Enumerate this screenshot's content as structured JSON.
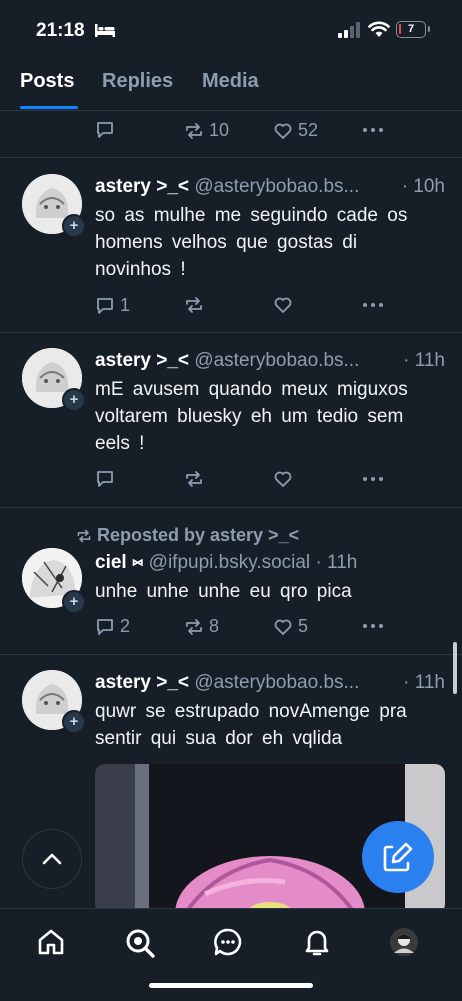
{
  "status_bar": {
    "time": "21:18",
    "battery": "7",
    "battery_level": 0.07,
    "battery_color": "#e5484d"
  },
  "tabs": [
    {
      "label": "Posts",
      "active": true
    },
    {
      "label": "Replies",
      "active": false
    },
    {
      "label": "Media",
      "active": false
    }
  ],
  "colors": {
    "background": "#161e27",
    "accent": "#1083fe",
    "muted": "#8d9db0",
    "compose": "#2a80ef"
  },
  "top_partial": {
    "reposts": "10",
    "likes": "52"
  },
  "posts": [
    {
      "name": "astery >_<",
      "handle": "@asterybobao.bs...",
      "time": "· 10h",
      "text": "so as mulhe me seguindo cade os homens velhos que gostas di novinhos !",
      "replies": "1",
      "reposts": "",
      "likes": ""
    },
    {
      "name": "astery >_<",
      "handle": "@asterybobao.bs...",
      "time": "· 11h",
      "text": "mE avusem quando meux miguxos voltarem bluesky eh um tedio sem eels !",
      "replies": "",
      "reposts": "",
      "likes": ""
    },
    {
      "repost_label": "Reposted by astery >_<",
      "name": "ciel ⑅",
      "handle": "@ifpupi.bsky.social",
      "time": "· 11h",
      "text": "unhe unhe unhe eu qro pica",
      "replies": "2",
      "reposts": "8",
      "likes": "5"
    },
    {
      "name": "astery >_<",
      "handle": "@asterybobao.bs...",
      "time": "· 11h",
      "text": "quwr se estrupado novAmenge pra sentir qui sua dor eh vqlida"
    }
  ],
  "bottom_nav": [
    "home-icon",
    "search-icon",
    "chat-icon",
    "bell-icon",
    "profile-avatar"
  ]
}
